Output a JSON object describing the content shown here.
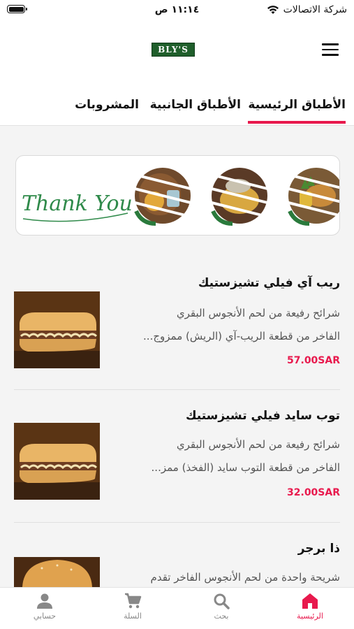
{
  "status_bar": {
    "carrier": "شركة الاتصالات",
    "time": "١١:١٤ ص"
  },
  "header": {
    "logo_text": "BLY'S"
  },
  "tabs": [
    {
      "label": "الأطباق الرئيسية",
      "active": true
    },
    {
      "label": "الأطباق الجانبية",
      "active": false
    },
    {
      "label": "المشروبات",
      "active": false
    }
  ],
  "banner": {
    "text": "Thank You"
  },
  "items": [
    {
      "title": "ريب آي فيلي تشيزستيك",
      "desc_line1": "شرائح رفيعة من لحم الأنجوس البقري",
      "desc_line2": "الفاخر من قطعة الريب-آي (الريش) ممزوج...",
      "price": "57.00SAR"
    },
    {
      "title": "توب سايد فيلي تشيزستيك",
      "desc_line1": "شرائح رفيعة من لحم الأنجوس البقري",
      "desc_line2": "الفاخر من قطعة التوب سايد (الفخذ) ممز...",
      "price": "32.00SAR"
    },
    {
      "title": "ذا برجر",
      "desc_line1": "شريحة واحدة من لحم الأنجوس الفاخر تقدم"
    }
  ],
  "bottom_nav": [
    {
      "label": "الرئيسية",
      "icon": "home-icon",
      "active": true
    },
    {
      "label": "بحث",
      "icon": "search-icon",
      "active": false
    },
    {
      "label": "السلة",
      "icon": "cart-icon",
      "active": false
    },
    {
      "label": "حسابي",
      "icon": "person-icon",
      "active": false
    }
  ],
  "colors": {
    "accent": "#e8194d",
    "brand_green": "#1f5e2b"
  }
}
